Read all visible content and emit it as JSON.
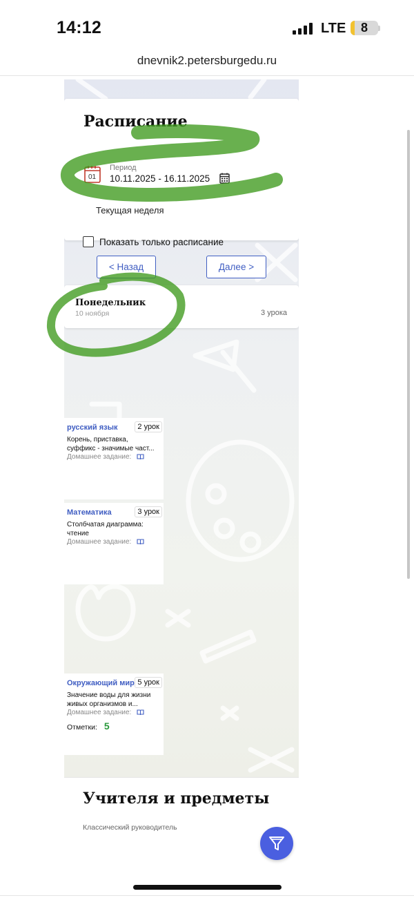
{
  "status_bar": {
    "time": "14:12",
    "network": "LTE",
    "battery_level": "8",
    "battery_fraction": 0.08,
    "battery_color": "#f2c230"
  },
  "browser": {
    "url": "dnevnik2.petersburgedu.ru"
  },
  "schedule": {
    "title": "Расписание",
    "period_icon": "calendar-page-icon",
    "period_label": "Период",
    "period_value": "10.11.2025 - 16.11.2025",
    "calendar_icon": "calendar-icon",
    "current_week": "Текущая неделя",
    "show_only_label": "Показать только расписание",
    "show_only_checked": false
  },
  "navigation": {
    "back_label": "< Назад",
    "next_label": "Далее >"
  },
  "day": {
    "name": "Понедельник",
    "date": "10 ноября",
    "lesson_count": "3 урока"
  },
  "lessons": [
    {
      "subject": "русский язык",
      "number": "2 урок",
      "topic": "Корень, приставка,",
      "topic_2": "суффикс - значимые част...",
      "homework_label": "Домашнее задание:",
      "homework_icon": "book-icon"
    },
    {
      "subject": "Математика",
      "number": "3 урок",
      "topic": "Столбчатая диаграмма:",
      "topic_2": "чтение",
      "homework_label": "Домашнее задание:",
      "homework_icon": "book-icon"
    },
    {
      "subject": "Окружающий мир",
      "number": "5 урок",
      "topic": "Значение воды для жизни",
      "topic_2": "живых организмов и...",
      "homework_label": "Домашнее задание:",
      "homework_icon": "book-icon",
      "marks_label": "Отметки:",
      "mark": "5"
    }
  ],
  "teachers": {
    "title": "Учителя и предметы",
    "subtitle": "Классический руководитель"
  },
  "colors": {
    "accent": "#3f5dc2",
    "fab": "#4a5fe0",
    "mark_good": "#2a9a3c",
    "highlight_scribble": "#3f9a1e"
  },
  "fab_icon": "filter-icon"
}
